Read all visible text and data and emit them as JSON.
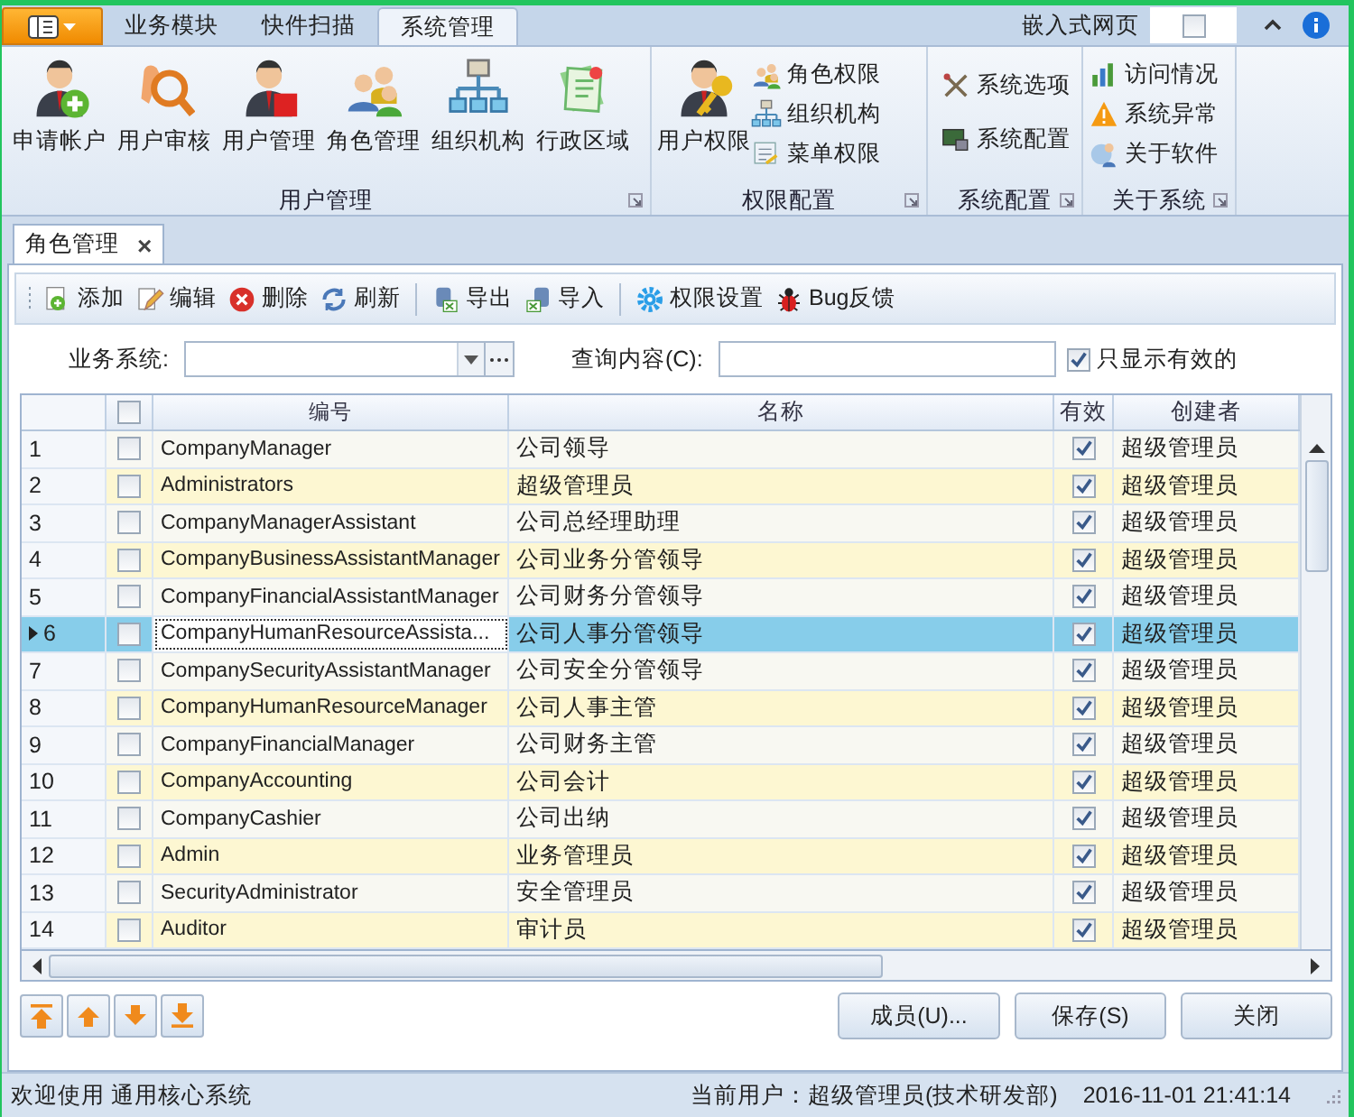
{
  "ribbon_tabs": [
    {
      "label": "业务模块",
      "selected": false
    },
    {
      "label": "快件扫描",
      "selected": false
    },
    {
      "label": "系统管理",
      "selected": true
    }
  ],
  "embed": {
    "label": "嵌入式网页",
    "checked": false
  },
  "ribbon_groups": [
    {
      "title": "用户管理",
      "large": [
        "申请帐户",
        "用户审核",
        "用户管理",
        "角色管理",
        "组织机构",
        "行政区域"
      ]
    },
    {
      "title": "权限配置",
      "large": [
        "用户权限"
      ],
      "small": [
        "角色权限",
        "组织机构",
        "菜单权限"
      ]
    },
    {
      "title": "系统配置",
      "small": [
        "系统选项",
        "系统配置"
      ]
    },
    {
      "title": "关于系统",
      "small": [
        "访问情况",
        "系统异常",
        "关于软件"
      ]
    }
  ],
  "document_tab": {
    "label": "角色管理",
    "close": "×"
  },
  "toolbar": [
    "添加",
    "编辑",
    "删除",
    "刷新",
    "导出",
    "导入",
    "权限设置",
    "Bug反馈"
  ],
  "filter": {
    "system_label": "业务系统:",
    "query_label": "查询内容(C):",
    "only_valid": {
      "label": "只显示有效的",
      "checked": true
    }
  },
  "grid": {
    "columns": [
      "编号",
      "名称",
      "有效",
      "创建者"
    ],
    "all_checked": false,
    "rows": [
      {
        "number": "1",
        "checked": false,
        "code": "CompanyManager",
        "name": "公司领导",
        "valid": true,
        "creator": "超级管理员",
        "selected": false
      },
      {
        "number": "2",
        "checked": false,
        "code": "Administrators",
        "name": "超级管理员",
        "valid": true,
        "creator": "超级管理员",
        "selected": false
      },
      {
        "number": "3",
        "checked": false,
        "code": "CompanyManagerAssistant",
        "name": "公司总经理助理",
        "valid": true,
        "creator": "超级管理员",
        "selected": false
      },
      {
        "number": "4",
        "checked": false,
        "code": "CompanyBusinessAssistantManager",
        "name": "公司业务分管领导",
        "valid": true,
        "creator": "超级管理员",
        "selected": false
      },
      {
        "number": "5",
        "checked": false,
        "code": "CompanyFinancialAssistantManager",
        "name": "公司财务分管领导",
        "valid": true,
        "creator": "超级管理员",
        "selected": false
      },
      {
        "number": "6",
        "checked": false,
        "code": "CompanyHumanResourceAssista...",
        "name": "公司人事分管领导",
        "valid": true,
        "creator": "超级管理员",
        "selected": true
      },
      {
        "number": "7",
        "checked": false,
        "code": "CompanySecurityAssistantManager",
        "name": "公司安全分管领导",
        "valid": true,
        "creator": "超级管理员",
        "selected": false
      },
      {
        "number": "8",
        "checked": false,
        "code": "CompanyHumanResourceManager",
        "name": "公司人事主管",
        "valid": true,
        "creator": "超级管理员",
        "selected": false
      },
      {
        "number": "9",
        "checked": false,
        "code": "CompanyFinancialManager",
        "name": "公司财务主管",
        "valid": true,
        "creator": "超级管理员",
        "selected": false
      },
      {
        "number": "10",
        "checked": false,
        "code": "CompanyAccounting",
        "name": "公司会计",
        "valid": true,
        "creator": "超级管理员",
        "selected": false
      },
      {
        "number": "11",
        "checked": false,
        "code": "CompanyCashier",
        "name": "公司出纳",
        "valid": true,
        "creator": "超级管理员",
        "selected": false
      },
      {
        "number": "12",
        "checked": false,
        "code": "Admin",
        "name": "业务管理员",
        "valid": true,
        "creator": "超级管理员",
        "selected": false
      },
      {
        "number": "13",
        "checked": false,
        "code": "SecurityAdministrator",
        "name": "安全管理员",
        "valid": true,
        "creator": "超级管理员",
        "selected": false
      },
      {
        "number": "14",
        "checked": false,
        "code": "Auditor",
        "name": "审计员",
        "valid": true,
        "creator": "超级管理员",
        "selected": false
      }
    ]
  },
  "buttons": [
    "成员(U)...",
    "保存(S)",
    "关闭"
  ],
  "status_bar": {
    "welcome": "欢迎使用 通用核心系统",
    "user": "当前用户：超级管理员(技术研发部)",
    "time": "2016-11-01 21:41:14"
  }
}
